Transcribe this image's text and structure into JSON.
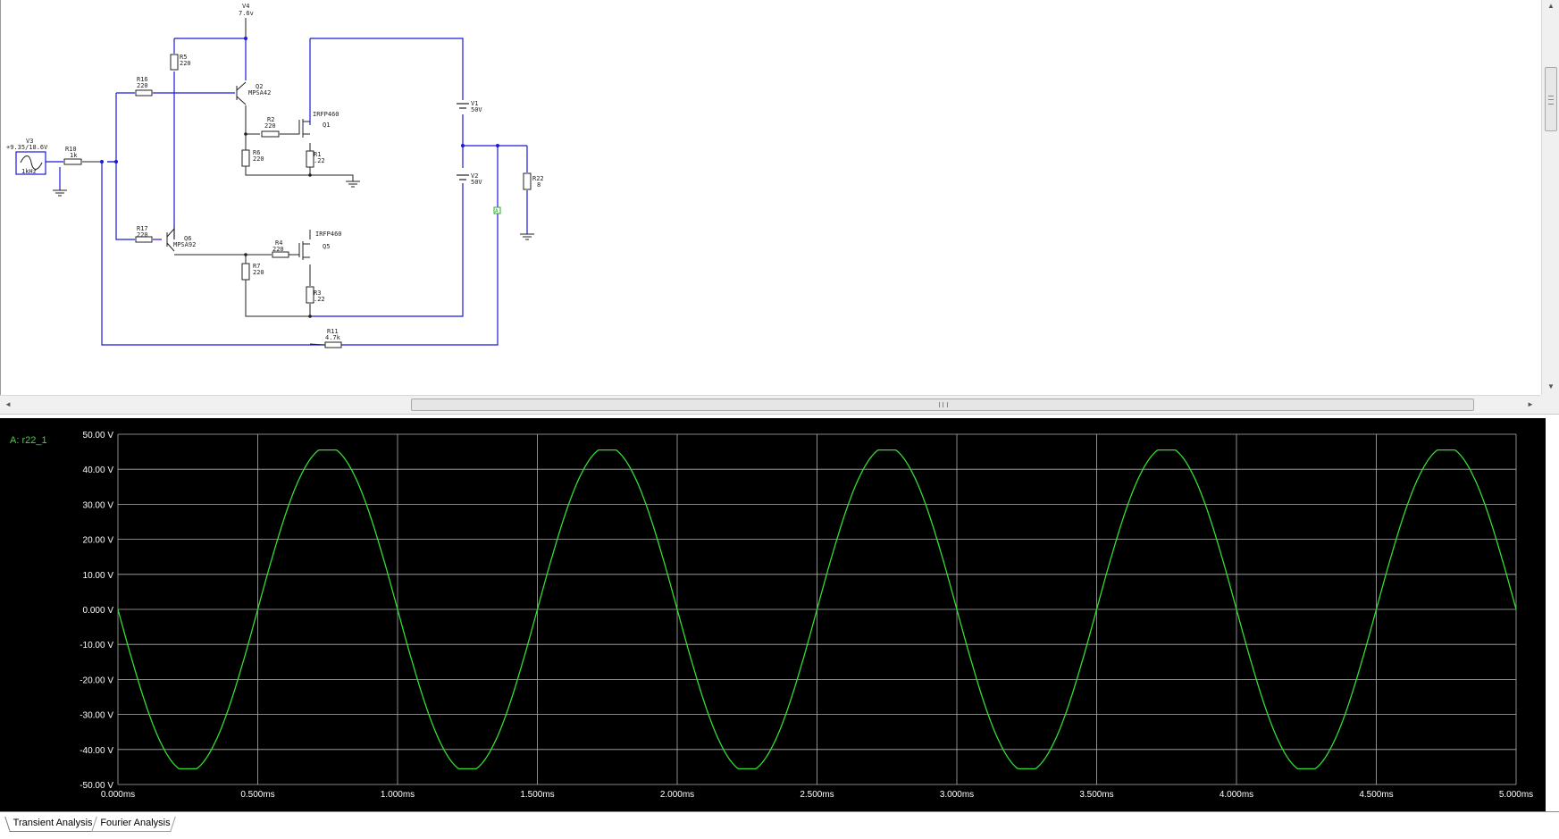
{
  "schematic": {
    "components": {
      "v4": {
        "name": "V4",
        "value": "7.6v"
      },
      "v3": {
        "name": "V3",
        "value": "+9.35/18.6V",
        "freq": "1kHz"
      },
      "r10": {
        "name": "R10",
        "value": "1k"
      },
      "r5": {
        "name": "R5",
        "value": "220"
      },
      "r16": {
        "name": "R16",
        "value": "220"
      },
      "q2": {
        "name": "Q2",
        "model": "MPSA42"
      },
      "r2": {
        "name": "R2",
        "value": "220"
      },
      "r6": {
        "name": "R6",
        "value": "220"
      },
      "q1": {
        "name": "Q1",
        "model": "IRFP460"
      },
      "r1": {
        "name": "R1",
        "value": ".22"
      },
      "v1": {
        "name": "V1",
        "value": "50V"
      },
      "v2": {
        "name": "V2",
        "value": "50V"
      },
      "r22": {
        "name": "R22",
        "value": "8"
      },
      "r17": {
        "name": "R17",
        "value": "220"
      },
      "q6": {
        "name": "Q6",
        "model": "MPSA92"
      },
      "r4": {
        "name": "R4",
        "value": "220"
      },
      "q5": {
        "name": "Q5",
        "model": "IRFP460"
      },
      "r7": {
        "name": "R7",
        "value": "220"
      },
      "r3": {
        "name": "R3",
        "value": ".22"
      },
      "r11": {
        "name": "R11",
        "value": "4.7k"
      }
    },
    "probe": "A"
  },
  "grapher": {
    "trace_label": "A: r22_1",
    "trace_color": "#33dd33",
    "background": "#000000",
    "grid_color": "#b0b0b0",
    "label_color": "#ffffff"
  },
  "chart_data": {
    "type": "line",
    "xlabel": "",
    "ylabel": "",
    "xlim": [
      0,
      5
    ],
    "ylim": [
      -50,
      50
    ],
    "x_ticks": [
      "0.000ms",
      "0.500ms",
      "1.000ms",
      "1.500ms",
      "2.000ms",
      "2.500ms",
      "3.000ms",
      "3.500ms",
      "4.000ms",
      "4.500ms",
      "5.000ms"
    ],
    "y_ticks": [
      "50.00 V",
      "40.00 V",
      "30.00 V",
      "20.00 V",
      "10.00 V",
      "0.000 V",
      "-10.00 V",
      "-20.00 V",
      "-30.00 V",
      "-40.00 V",
      "-50.00 V"
    ],
    "grid": true,
    "series": [
      {
        "name": "A: r22_1",
        "frequency_khz": 1,
        "amplitude_v": 45.5,
        "phase": "inverted sine",
        "x_ms": [
          0,
          0.125,
          0.25,
          0.375,
          0.5,
          0.625,
          0.75,
          0.875,
          1.0,
          1.125,
          1.25,
          1.375,
          1.5,
          1.625,
          1.75,
          1.875,
          2.0,
          2.125,
          2.25,
          2.375,
          2.5,
          2.625,
          2.75,
          2.875,
          3.0,
          3.125,
          3.25,
          3.375,
          3.5,
          3.625,
          3.75,
          3.875,
          4.0,
          4.125,
          4.25,
          4.375,
          4.5,
          4.625,
          4.75,
          4.875,
          5.0
        ],
        "y_v": [
          0,
          -32.2,
          -45.5,
          -32.2,
          0,
          32.2,
          45.5,
          32.2,
          0,
          -32.2,
          -45.5,
          -32.2,
          0,
          32.2,
          45.5,
          32.2,
          0,
          -32.2,
          -45.5,
          -32.2,
          0,
          32.2,
          45.5,
          32.2,
          0,
          -32.2,
          -45.5,
          -32.2,
          0,
          32.2,
          45.5,
          32.2,
          0,
          -32.2,
          -45.5,
          -32.2,
          0,
          32.2,
          45.5,
          32.2,
          0
        ]
      }
    ]
  },
  "tabs": [
    {
      "label": "Transient Analysis",
      "active": true
    },
    {
      "label": "Fourier Analysis",
      "active": false
    }
  ],
  "scrollbar": {
    "up_arrow": "▲",
    "down_arrow": "▼",
    "left_arrow": "◄",
    "right_arrow": "►"
  }
}
